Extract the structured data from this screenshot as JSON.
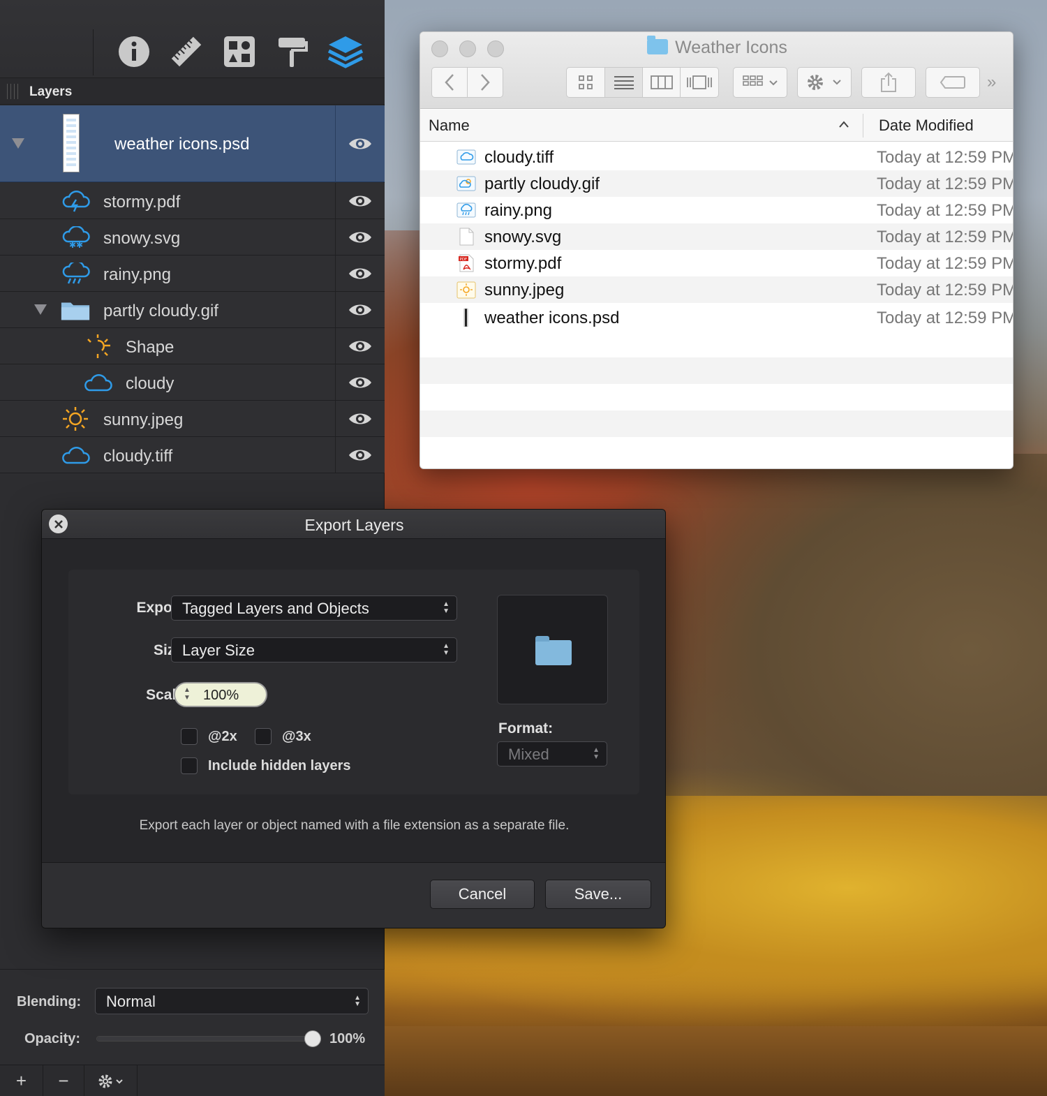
{
  "panel": {
    "toolbar_icons": [
      "info-icon",
      "ruler-icon",
      "grid-icon",
      "paint-roller-icon",
      "layers-icon"
    ],
    "header_title": "Layers",
    "layers": [
      {
        "label": "weather icons.psd",
        "icon": "psd-thumbnail-icon",
        "selected": true
      },
      {
        "label": "stormy.pdf",
        "icon": "stormy-cloud-icon"
      },
      {
        "label": "snowy.svg",
        "icon": "snowy-cloud-icon"
      },
      {
        "label": "rainy.png",
        "icon": "rainy-cloud-icon"
      },
      {
        "label": "partly cloudy.gif",
        "icon": "folder-icon"
      },
      {
        "label": "Shape",
        "icon": "partial-sun-icon"
      },
      {
        "label": "cloudy",
        "icon": "cloud-icon"
      },
      {
        "label": "sunny.jpeg",
        "icon": "sun-icon"
      },
      {
        "label": "cloudy.tiff",
        "icon": "cloud-icon"
      }
    ],
    "blending_label": "Blending:",
    "blending_value": "Normal",
    "opacity_label": "Opacity:",
    "opacity_value": "100%",
    "opacity_fraction": 1.0,
    "bottom_buttons": [
      "+",
      "−"
    ]
  },
  "finder": {
    "title": "Weather Icons",
    "col_name": "Name",
    "col_date": "Date Modified",
    "files": [
      {
        "name": "cloudy.tiff",
        "date": "Today at 12:59 PM",
        "icon": "cloud-file-icon"
      },
      {
        "name": "partly cloudy.gif",
        "date": "Today at 12:59 PM",
        "icon": "partly-cloudy-file-icon"
      },
      {
        "name": "rainy.png",
        "date": "Today at 12:59 PM",
        "icon": "rainy-file-icon"
      },
      {
        "name": "snowy.svg",
        "date": "Today at 12:59 PM",
        "icon": "blank-file-icon"
      },
      {
        "name": "stormy.pdf",
        "date": "Today at 12:59 PM",
        "icon": "pdf-file-icon"
      },
      {
        "name": "sunny.jpeg",
        "date": "Today at 12:59 PM",
        "icon": "sun-file-icon"
      },
      {
        "name": "weather icons.psd",
        "date": "Today at 12:59 PM",
        "icon": "psd-file-icon"
      }
    ]
  },
  "dialog": {
    "title": "Export Layers",
    "export_label": "Export:",
    "export_value": "Tagged Layers and Objects",
    "size_label": "Size:",
    "size_value": "Layer Size",
    "scale_label": "Scale:",
    "scale_value": "100%",
    "opt_2x": "@2x",
    "opt_3x": "@3x",
    "opt_hidden": "Include hidden layers",
    "format_label": "Format:",
    "format_value": "Mixed",
    "description": "Export each layer or object named with a file extension as a separate file.",
    "cancel_label": "Cancel",
    "save_label": "Save..."
  },
  "colors": {
    "selection": "#3d5478",
    "accent_blue": "#2f9be8",
    "sun_orange": "#f5a623"
  }
}
